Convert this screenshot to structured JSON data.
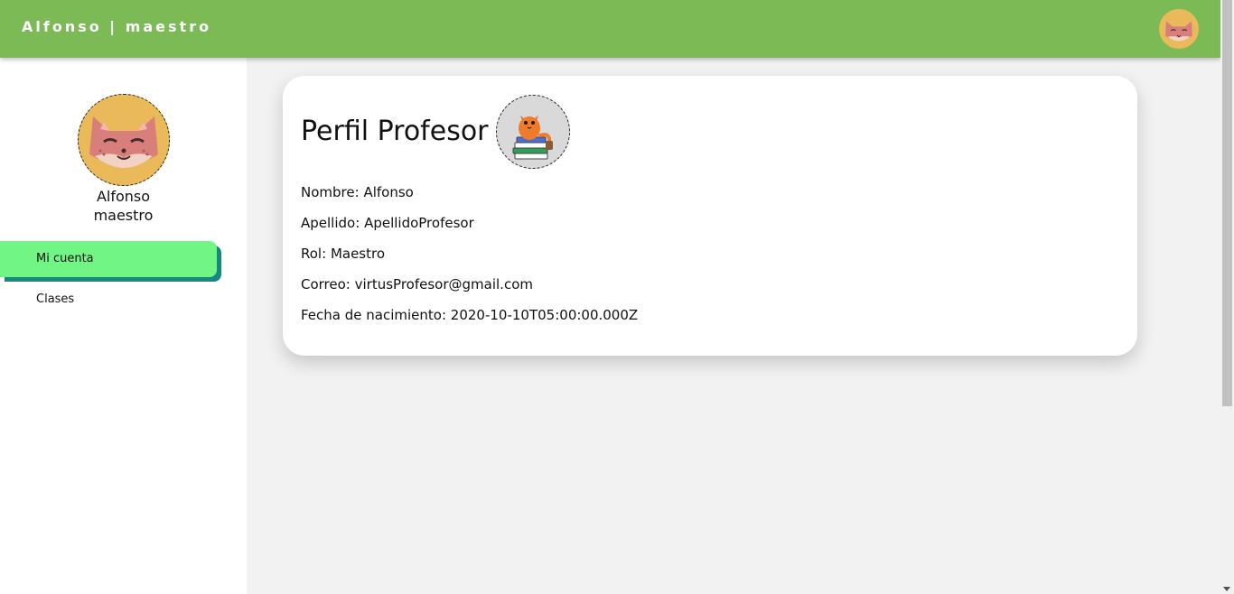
{
  "header": {
    "title": "Alfonso | maestro",
    "avatar_icon": "cat-avatar-icon"
  },
  "sidebar": {
    "avatar_icon": "cat-avatar-icon",
    "user_first": "Alfonso",
    "user_role": "maestro",
    "items": [
      {
        "label": "Mi cuenta",
        "active": true
      },
      {
        "label": "Clases",
        "active": false
      }
    ]
  },
  "profile": {
    "title": "Perfil Profesor",
    "avatar_icon": "cat-with-books-icon",
    "fields": [
      {
        "label": "Nombre:",
        "value": "Alfonso"
      },
      {
        "label": "Apellido:",
        "value": "ApellidoProfesor"
      },
      {
        "label": "Rol:",
        "value": "Maestro"
      },
      {
        "label": "Correo:",
        "value": "virtusProfesor@gmail.com"
      },
      {
        "label": "Fecha de nacimiento:",
        "value": "2020-10-10T05:00:00.000Z"
      }
    ]
  },
  "colors": {
    "header_bg": "#7cba55",
    "active_nav": "#71f585",
    "active_nav_shadow": "#17887d",
    "avatar_bg": "#e9b95a"
  }
}
